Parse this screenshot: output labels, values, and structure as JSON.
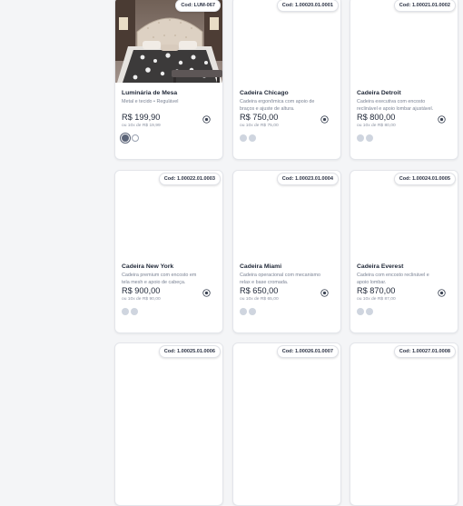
{
  "products": [
    {
      "code": "Cod: LUM-067",
      "name": "Luminária de Mesa",
      "desc": "Metal e tecido • Regulável",
      "price": "R$ 199,90",
      "installments": "ou 10x de R$ 19,99",
      "swatches": [
        "#5b6478",
        "#ffffff"
      ],
      "has_image": true
    },
    {
      "code": "Cod: 1.00020.01.0001",
      "name": "Cadeira Chicago",
      "desc": "Cadeira ergonômica com apoio de braços e ajuste de altura.",
      "price": "R$ 750,00",
      "installments": "ou 10x de R$ 75,00",
      "swatches": [
        "#cfd5df",
        "#cfd5df"
      ],
      "has_image": false
    },
    {
      "code": "Cod: 1.00021.01.0002",
      "name": "Cadeira Detroit",
      "desc": "Cadeira executiva com encosto reclinável e apoio lombar ajustável.",
      "price": "R$ 800,00",
      "installments": "ou 10x de R$ 80,00",
      "swatches": [
        "#cfd5df",
        "#cfd5df"
      ],
      "has_image": false
    },
    {
      "code": "Cod: 1.00022.01.0003",
      "name": "Cadeira New York",
      "desc": "Cadeira premium com encosto em tela mesh e apoio de cabeça.",
      "price": "R$ 900,00",
      "installments": "ou 10x de R$ 90,00",
      "swatches": [
        "#cfd5df",
        "#cfd5df"
      ],
      "has_image": false
    },
    {
      "code": "Cod: 1.00023.01.0004",
      "name": "Cadeira Miami",
      "desc": "Cadeira operacional com mecanismo relax e base cromada.",
      "price": "R$ 650,00",
      "installments": "ou 10x de R$ 65,00",
      "swatches": [
        "#cfd5df",
        "#cfd5df"
      ],
      "has_image": false
    },
    {
      "code": "Cod: 1.00024.01.0005",
      "name": "Cadeira Everest",
      "desc": "Cadeira com encosto reclinável e apoio lombar.",
      "price": "R$ 870,00",
      "installments": "ou 10x de R$ 87,00",
      "swatches": [
        "#cfd5df",
        "#cfd5df"
      ],
      "has_image": false
    },
    {
      "code": "Cod: 1.00025.01.0006",
      "name": "",
      "desc": "",
      "price": "",
      "installments": "",
      "swatches": [],
      "has_image": false
    },
    {
      "code": "Cod: 1.00026.01.0007",
      "name": "",
      "desc": "",
      "price": "",
      "installments": "",
      "swatches": [],
      "has_image": false
    },
    {
      "code": "Cod: 1.00027.01.0008",
      "name": "",
      "desc": "",
      "price": "",
      "installments": "",
      "swatches": [],
      "has_image": false
    }
  ],
  "icons": {
    "cart": "add-to-cart-icon"
  }
}
